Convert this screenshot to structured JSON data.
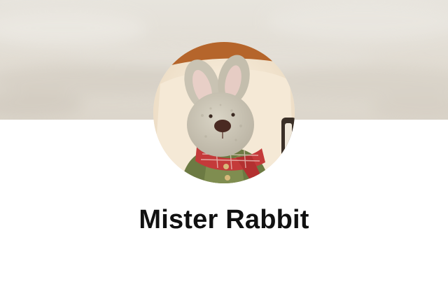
{
  "profile": {
    "name": "Mister Rabbit",
    "avatar_subject": "plush-rabbit-toy"
  },
  "cover": {
    "subject": "cloudy-sky"
  },
  "colors": {
    "background": "#ffffff",
    "cover_base": "#e2ddd4",
    "name_text": "#111111"
  }
}
